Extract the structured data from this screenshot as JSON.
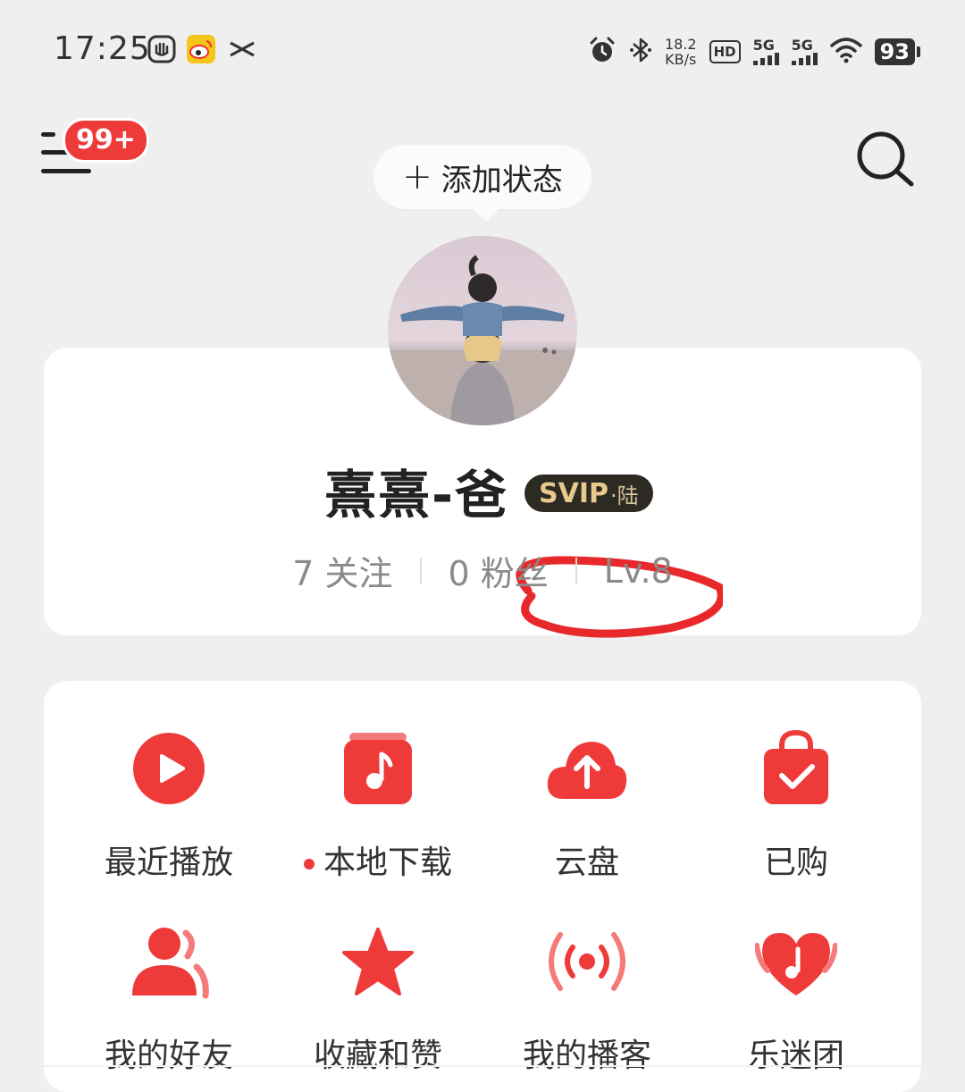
{
  "status_bar": {
    "time": "17:25",
    "net_speed": "18.2",
    "net_unit": "KB/s",
    "hd": "HD",
    "net_5g_1": "5G",
    "net_5g_2": "5G",
    "battery": "93",
    "icons": [
      "hand-app-icon",
      "weibo-icon",
      "capcut-icon",
      "alarm-icon",
      "bluetooth-icon",
      "wifi-icon"
    ]
  },
  "header": {
    "notification_badge": "99+",
    "add_status": "添加状态",
    "add_status_plus": "+"
  },
  "profile": {
    "username": "熹熹-爸",
    "vip_badge": "SVIP",
    "vip_level": "·陆",
    "following": "7 关注",
    "followers": "0 粉丝",
    "level": "Lv.8"
  },
  "features": [
    {
      "label": "最近播放",
      "icon": "play-icon"
    },
    {
      "label": "本地下载",
      "icon": "music-note-icon",
      "dot": true
    },
    {
      "label": "云盘",
      "icon": "cloud-upload-icon"
    },
    {
      "label": "已购",
      "icon": "shopping-bag-icon"
    },
    {
      "label": "我的好友",
      "icon": "friends-icon"
    },
    {
      "label": "收藏和赞",
      "icon": "star-icon"
    },
    {
      "label": "我的播客",
      "icon": "podcast-icon"
    },
    {
      "label": "乐迷团",
      "icon": "heart-note-icon"
    }
  ],
  "colors": {
    "accent": "#ef3a3a",
    "background": "#efefef",
    "card": "#ffffff",
    "vip_bg": "#2c2a22",
    "vip_text": "#e8c98d"
  }
}
